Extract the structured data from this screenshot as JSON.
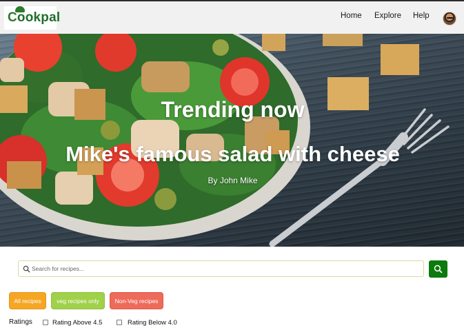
{
  "brand": {
    "name_first": "C",
    "name_rest": "ookpal"
  },
  "nav": {
    "home": "Home",
    "explore": "Explore",
    "help": "Help"
  },
  "hero": {
    "title": "Trending now",
    "recipe_name": "Mike's famous salad with cheese",
    "author": "By John Mike"
  },
  "search": {
    "placeholder": "Search for recipes...",
    "value": ""
  },
  "filters": {
    "all": "All recipes",
    "veg": "veg recipes only",
    "nonveg": "Non-Veg recipes"
  },
  "ratings": {
    "label": "Ratings",
    "above": "Rating Above 4.5",
    "below": "Rating Below 4.0"
  },
  "colors": {
    "brand_green": "#1e6f2a",
    "search_button": "#0d7a0d",
    "pill_all": "#f5a623",
    "pill_veg": "#9fd14a",
    "pill_nonveg": "#ee6a5a"
  },
  "icons": {
    "search": "search-icon",
    "avatar": "user-avatar"
  }
}
